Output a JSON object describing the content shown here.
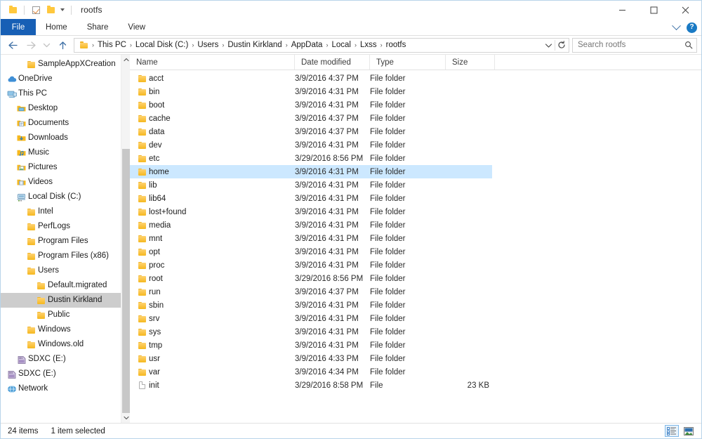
{
  "window": {
    "title": "rootfs",
    "quick_access": [
      {
        "name": "folder-icon",
        "label": "Folder"
      },
      {
        "name": "properties-icon",
        "label": "Properties"
      },
      {
        "name": "new-folder-icon",
        "label": "New folder"
      },
      {
        "name": "customize-quick-access-icon",
        "label": "Customize Quick Access Toolbar"
      }
    ],
    "controls": {
      "minimize": "Minimize",
      "maximize": "Maximize",
      "close": "Close"
    }
  },
  "ribbon": {
    "tabs": [
      {
        "label": "File",
        "active": true
      },
      {
        "label": "Home",
        "active": false
      },
      {
        "label": "Share",
        "active": false
      },
      {
        "label": "View",
        "active": false
      }
    ],
    "expand_label": "Expand the Ribbon",
    "help_label": "?"
  },
  "address": {
    "back_label": "Back",
    "forward_label": "Forward",
    "recent_label": "Recent locations",
    "up_label": "Up to Users",
    "breadcrumbs": [
      "This PC",
      "Local Disk (C:)",
      "Users",
      "Dustin Kirkland",
      "AppData",
      "Local",
      "Lxss",
      "rootfs"
    ],
    "separator": "›",
    "previous_locations_label": "Previous locations",
    "refresh_label": "Refresh"
  },
  "search": {
    "placeholder": "Search rootfs",
    "value": "",
    "icon": "search-icon"
  },
  "sidebar": {
    "items": [
      {
        "label": "SampleAppXCreation",
        "icon": "folder-icon",
        "indent": 2,
        "selected": false
      },
      {
        "label": "OneDrive",
        "icon": "cloud-icon",
        "indent": 0,
        "selected": false
      },
      {
        "label": "This PC",
        "icon": "pc-icon",
        "indent": 0,
        "selected": false
      },
      {
        "label": "Desktop",
        "icon": "desktop-folder-icon",
        "indent": 1,
        "selected": false
      },
      {
        "label": "Documents",
        "icon": "documents-folder-icon",
        "indent": 1,
        "selected": false
      },
      {
        "label": "Downloads",
        "icon": "downloads-folder-icon",
        "indent": 1,
        "selected": false
      },
      {
        "label": "Music",
        "icon": "music-folder-icon",
        "indent": 1,
        "selected": false
      },
      {
        "label": "Pictures",
        "icon": "pictures-folder-icon",
        "indent": 1,
        "selected": false
      },
      {
        "label": "Videos",
        "icon": "videos-folder-icon",
        "indent": 1,
        "selected": false
      },
      {
        "label": "Local Disk (C:)",
        "icon": "drive-icon",
        "indent": 1,
        "selected": false
      },
      {
        "label": "Intel",
        "icon": "folder-icon",
        "indent": 2,
        "selected": false
      },
      {
        "label": "PerfLogs",
        "icon": "folder-icon",
        "indent": 2,
        "selected": false
      },
      {
        "label": "Program Files",
        "icon": "folder-icon",
        "indent": 2,
        "selected": false
      },
      {
        "label": "Program Files (x86)",
        "icon": "folder-icon",
        "indent": 2,
        "selected": false
      },
      {
        "label": "Users",
        "icon": "folder-icon",
        "indent": 2,
        "selected": false
      },
      {
        "label": "Default.migrated",
        "icon": "folder-icon",
        "indent": 3,
        "selected": false
      },
      {
        "label": "Dustin Kirkland",
        "icon": "folder-icon",
        "indent": 3,
        "selected": true
      },
      {
        "label": "Public",
        "icon": "folder-icon",
        "indent": 3,
        "selected": false
      },
      {
        "label": "Windows",
        "icon": "folder-icon",
        "indent": 2,
        "selected": false
      },
      {
        "label": "Windows.old",
        "icon": "folder-icon",
        "indent": 2,
        "selected": false
      },
      {
        "label": "SDXC (E:)",
        "icon": "sd-card-icon",
        "indent": 1,
        "selected": false
      },
      {
        "label": "SDXC (E:)",
        "icon": "sd-card-icon",
        "indent": 0,
        "selected": false
      },
      {
        "label": "Network",
        "icon": "network-icon",
        "indent": 0,
        "selected": false
      }
    ]
  },
  "filelist": {
    "columns": [
      {
        "label": "Name"
      },
      {
        "label": "Date modified"
      },
      {
        "label": "Type"
      },
      {
        "label": "Size"
      }
    ],
    "rows": [
      {
        "name": "acct",
        "date": "3/9/2016 4:37 PM",
        "type": "File folder",
        "size": "",
        "icon": "folder-icon",
        "selected": false
      },
      {
        "name": "bin",
        "date": "3/9/2016 4:31 PM",
        "type": "File folder",
        "size": "",
        "icon": "folder-icon",
        "selected": false
      },
      {
        "name": "boot",
        "date": "3/9/2016 4:31 PM",
        "type": "File folder",
        "size": "",
        "icon": "folder-icon",
        "selected": false
      },
      {
        "name": "cache",
        "date": "3/9/2016 4:37 PM",
        "type": "File folder",
        "size": "",
        "icon": "folder-icon",
        "selected": false
      },
      {
        "name": "data",
        "date": "3/9/2016 4:37 PM",
        "type": "File folder",
        "size": "",
        "icon": "folder-icon",
        "selected": false
      },
      {
        "name": "dev",
        "date": "3/9/2016 4:31 PM",
        "type": "File folder",
        "size": "",
        "icon": "folder-icon",
        "selected": false
      },
      {
        "name": "etc",
        "date": "3/29/2016 8:56 PM",
        "type": "File folder",
        "size": "",
        "icon": "folder-icon",
        "selected": false
      },
      {
        "name": "home",
        "date": "3/9/2016 4:31 PM",
        "type": "File folder",
        "size": "",
        "icon": "folder-icon",
        "selected": true
      },
      {
        "name": "lib",
        "date": "3/9/2016 4:31 PM",
        "type": "File folder",
        "size": "",
        "icon": "folder-icon",
        "selected": false
      },
      {
        "name": "lib64",
        "date": "3/9/2016 4:31 PM",
        "type": "File folder",
        "size": "",
        "icon": "folder-icon",
        "selected": false
      },
      {
        "name": "lost+found",
        "date": "3/9/2016 4:31 PM",
        "type": "File folder",
        "size": "",
        "icon": "folder-icon",
        "selected": false
      },
      {
        "name": "media",
        "date": "3/9/2016 4:31 PM",
        "type": "File folder",
        "size": "",
        "icon": "folder-icon",
        "selected": false
      },
      {
        "name": "mnt",
        "date": "3/9/2016 4:31 PM",
        "type": "File folder",
        "size": "",
        "icon": "folder-icon",
        "selected": false
      },
      {
        "name": "opt",
        "date": "3/9/2016 4:31 PM",
        "type": "File folder",
        "size": "",
        "icon": "folder-icon",
        "selected": false
      },
      {
        "name": "proc",
        "date": "3/9/2016 4:31 PM",
        "type": "File folder",
        "size": "",
        "icon": "folder-icon",
        "selected": false
      },
      {
        "name": "root",
        "date": "3/29/2016 8:56 PM",
        "type": "File folder",
        "size": "",
        "icon": "folder-icon",
        "selected": false
      },
      {
        "name": "run",
        "date": "3/9/2016 4:37 PM",
        "type": "File folder",
        "size": "",
        "icon": "folder-icon",
        "selected": false
      },
      {
        "name": "sbin",
        "date": "3/9/2016 4:31 PM",
        "type": "File folder",
        "size": "",
        "icon": "folder-icon",
        "selected": false
      },
      {
        "name": "srv",
        "date": "3/9/2016 4:31 PM",
        "type": "File folder",
        "size": "",
        "icon": "folder-icon",
        "selected": false
      },
      {
        "name": "sys",
        "date": "3/9/2016 4:31 PM",
        "type": "File folder",
        "size": "",
        "icon": "folder-icon",
        "selected": false
      },
      {
        "name": "tmp",
        "date": "3/9/2016 4:31 PM",
        "type": "File folder",
        "size": "",
        "icon": "folder-icon",
        "selected": false
      },
      {
        "name": "usr",
        "date": "3/9/2016 4:33 PM",
        "type": "File folder",
        "size": "",
        "icon": "folder-icon",
        "selected": false
      },
      {
        "name": "var",
        "date": "3/9/2016 4:34 PM",
        "type": "File folder",
        "size": "",
        "icon": "folder-icon",
        "selected": false
      },
      {
        "name": "init",
        "date": "3/29/2016 8:58 PM",
        "type": "File",
        "size": "23 KB",
        "icon": "file-icon",
        "selected": false
      }
    ]
  },
  "status": {
    "item_count": "24 items",
    "selection": "1 item selected",
    "views": [
      {
        "name": "details-view-button",
        "label": "Details view",
        "active": true
      },
      {
        "name": "large-icons-view-button",
        "label": "Large icons view",
        "active": false
      }
    ]
  },
  "colors": {
    "accent": "#175fb5",
    "selection": "#cce8ff",
    "tree_selection": "#cdcdcd",
    "folder": "#f6b81f",
    "help": "#1a7ac4"
  }
}
